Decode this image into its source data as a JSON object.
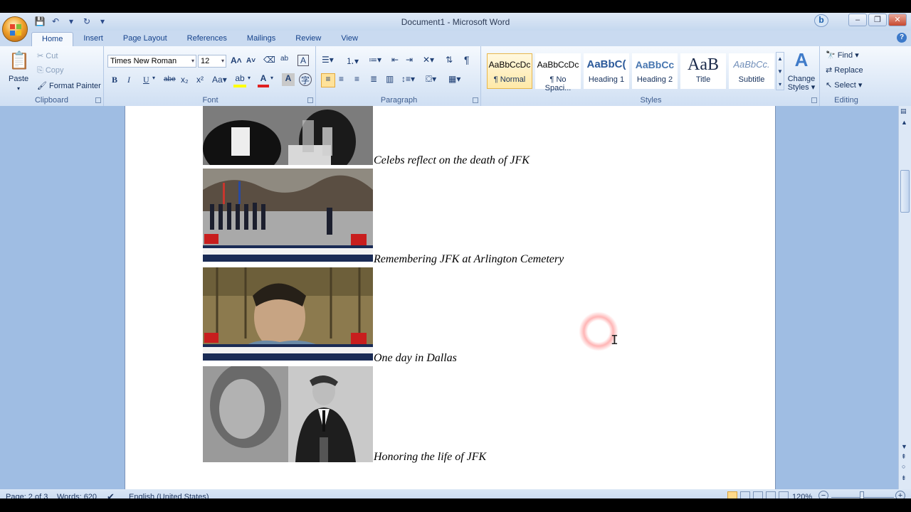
{
  "window": {
    "title": "Document1 - Microsoft Word"
  },
  "qat": {
    "save_icon": "save-icon",
    "undo_icon": "undo-icon",
    "redo_icon": "redo-icon"
  },
  "tabs": [
    "Home",
    "Insert",
    "Page Layout",
    "References",
    "Mailings",
    "Review",
    "View"
  ],
  "active_tab": "Home",
  "clipboard": {
    "paste": "Paste",
    "cut": "Cut",
    "copy": "Copy",
    "format_painter": "Format Painter",
    "label": "Clipboard"
  },
  "font": {
    "name": "Times New Roman",
    "size": "12",
    "label": "Font",
    "bold": "B",
    "italic": "I",
    "underline": "U",
    "strike": "abe",
    "sub": "x₂",
    "sup": "x²",
    "case": "Aa",
    "grow": "A",
    "shrink": "A",
    "clear": "A",
    "highlight_color": "#ffff00",
    "font_color": "#e02020"
  },
  "paragraph": {
    "label": "Paragraph",
    "pilcrow": "¶"
  },
  "styles": {
    "label": "Styles",
    "items": [
      {
        "preview": "AaBbCcDc",
        "name": "¶ Normal"
      },
      {
        "preview": "AaBbCcDc",
        "name": "¶ No Spaci..."
      },
      {
        "preview": "AaBbC(",
        "name": "Heading 1"
      },
      {
        "preview": "AaBbCc",
        "name": "Heading 2"
      },
      {
        "preview": "AaB",
        "name": "Title"
      },
      {
        "preview": "AaBbCc.",
        "name": "Subtitle"
      }
    ],
    "change_styles": "Change Styles"
  },
  "editing": {
    "label": "Editing",
    "find": "Find",
    "replace": "Replace",
    "select": "Select"
  },
  "document": {
    "captions": [
      "Celebs reflect on the death of JFK",
      "Remembering JFK at Arlington Cemetery",
      "One day in Dallas",
      "Honoring the life of JFK"
    ]
  },
  "status": {
    "page": "Page: 2 of 3",
    "words": "Words: 620",
    "language": "English (United States)",
    "zoom": "120%"
  }
}
